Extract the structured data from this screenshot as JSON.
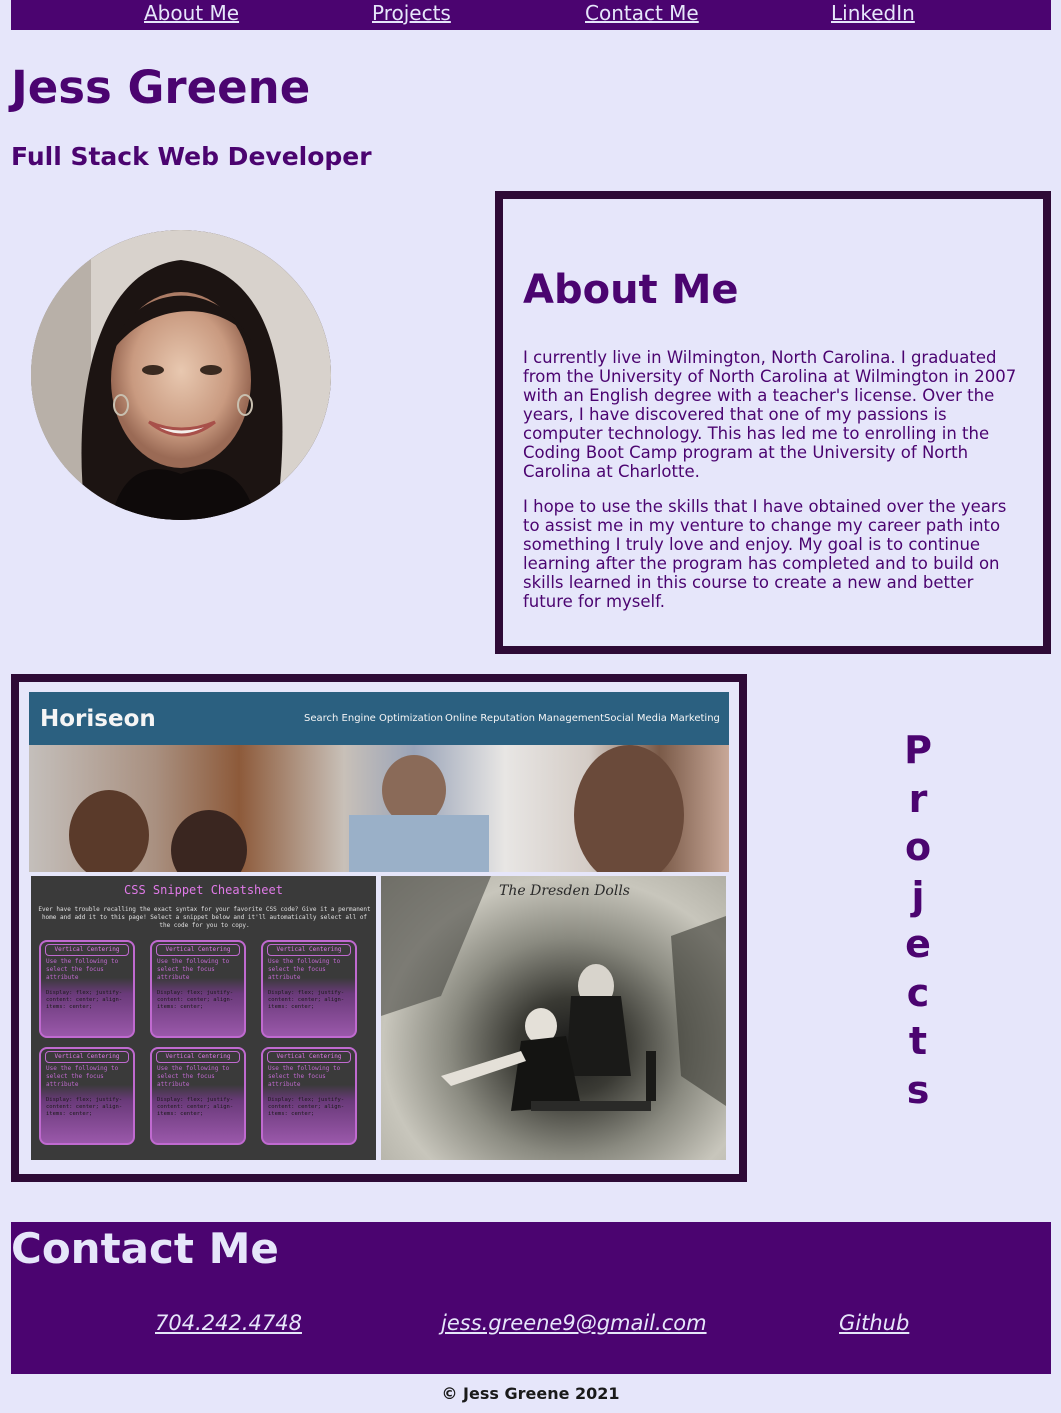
{
  "nav": {
    "items": [
      {
        "label": "About Me"
      },
      {
        "label": "Projects"
      },
      {
        "label": "Contact Me"
      },
      {
        "label": "LinkedIn"
      }
    ]
  },
  "header": {
    "name": "Jess Greene",
    "role": "Full Stack Web Developer"
  },
  "about": {
    "title": "About Me",
    "paragraph1": "I currently live in Wilmington, North Carolina. I graduated from the University of North Carolina at Wilmington in 2007 with an English degree with a teacher's license. Over the years, I have discovered that one of my passions is computer technology. This has led me to enrolling in the Coding Boot Camp program at the University of North Carolina at Charlotte.",
    "paragraph2": "I hope to use the skills that I have obtained over the years to assist me in my venture to change my career path into something I truly love and enjoy. My goal is to continue learning after the program has completed and to build on skills learned in this course to create a new and better future for myself."
  },
  "projects": {
    "label_letters": [
      "P",
      "r",
      "o",
      "j",
      "e",
      "c",
      "t",
      "s"
    ],
    "horiseon": {
      "logo": "Horiseon",
      "links": [
        "Search Engine Optimization",
        "Online Reputation Management",
        "Social Media Marketing"
      ]
    },
    "css_cheatsheet": {
      "title": "CSS Snippet Cheatsheet",
      "subtitle": "Ever have trouble recalling the exact syntax for your favorite CSS code? Give it a permanent home and add it to this page! Select a snippet below and it'll automatically select all of the code for you to copy.",
      "card_title": "Vertical Centering",
      "card_desc": "Use the following to select the focus attribute",
      "card_code": "Display: flex; justify-content: center; align-items: center;"
    },
    "dresden": {
      "title": "The Dresden Dolls"
    }
  },
  "contact": {
    "title": "Contact Me",
    "phone": "704.242.4748",
    "email": "jess.greene9@gmail.com",
    "github": "Github"
  },
  "footer": {
    "text": "© Jess Greene 2021"
  },
  "colors": {
    "background": "#e6e6fa",
    "primary": "#4b0470",
    "border": "#2e0a36"
  }
}
